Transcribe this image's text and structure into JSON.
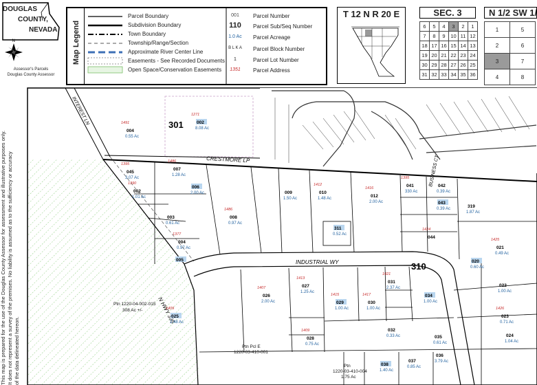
{
  "county": {
    "line1": "DOUGLAS",
    "line2": "COUNTY,",
    "line3": "NEVADA",
    "footer1": "Assessor's Parcels",
    "footer2": "Douglas County Assessor"
  },
  "legend": {
    "title": "Map Legend",
    "left": [
      "Parcel Boundary",
      "Subdivision Boundary",
      "Town Boundary",
      "Township/Range/Section",
      "Approximate River Center Line",
      "Easements - See Recorded Documents",
      "Open Space/Conservation Easements"
    ],
    "right_symbols": [
      "001",
      "110",
      "1.0 Ac",
      "B L K  A",
      "1",
      "1351"
    ],
    "right": [
      "Parcel Number",
      "Parcel Sub/Seq Number",
      "Parcel Acreage",
      "Parcel Block Number",
      "Parcel Lot Number",
      "Parcel Address"
    ]
  },
  "township": {
    "title": "T 12 N  R 20 E"
  },
  "section": {
    "title": "SEC.  3",
    "grid": [
      [
        6,
        5,
        4,
        3,
        2,
        1
      ],
      [
        7,
        8,
        9,
        10,
        11,
        12
      ],
      [
        18,
        17,
        16,
        15,
        14,
        13
      ],
      [
        19,
        20,
        21,
        22,
        23,
        24
      ],
      [
        30,
        29,
        28,
        27,
        26,
        25
      ],
      [
        31,
        32,
        33,
        34,
        35,
        36
      ]
    ],
    "highlight": 3
  },
  "quarter": {
    "title": "N 1/2  SW 1/4",
    "grid": [
      [
        1,
        5
      ],
      [
        2,
        6
      ],
      [
        3,
        7
      ],
      [
        4,
        8
      ]
    ],
    "highlight": 3
  },
  "disclaimer": [
    "This map is prepared for the use of the Douglas County Assessor for assessment and illustrative purposes only.",
    "It does not represent a survey of the premises.  No liability is assumed as to the sufficiency or accuracy",
    "of the data delineated hereon."
  ],
  "map": {
    "roads": {
      "crestmore": "CRESTMORE LP",
      "industrial": "INDUSTRIAL WY",
      "hwy": "N HWY 395",
      "interest": "INTEREST LN",
      "business": "BUSINESS CT"
    },
    "block_numbers": [
      "301",
      "310"
    ],
    "parcels": [
      {
        "num": "002",
        "acres": "8.08 Ac",
        "addr": "1271"
      },
      {
        "num": "004",
        "acres": "0.55 Ac",
        "addr": "1491"
      },
      {
        "num": "045",
        "acres": "3.07 Ac",
        "addr": "1395"
      },
      {
        "num": "007",
        "acres": "1.28 Ac",
        "addr": "1486"
      },
      {
        "num": "006",
        "acres": "2.00 Ac",
        "addr": ""
      },
      {
        "num": "002",
        "acres": "1.01 Ac",
        "addr": "1390"
      },
      {
        "num": "003",
        "acres": "0.61 Ac",
        "addr": ""
      },
      {
        "num": "004",
        "acres": "0.97 Ac",
        "addr": "1377"
      },
      {
        "num": "005",
        "acres": "",
        "addr": ""
      },
      {
        "num": "008",
        "acres": "0.97 Ac",
        "addr": "1486"
      },
      {
        "num": "009",
        "acres": "1.50 Ac",
        "addr": ""
      },
      {
        "num": "010",
        "acres": "1.48 Ac",
        "addr": "1412"
      },
      {
        "num": "311",
        "acres": "0.52 Ac",
        "addr": ""
      },
      {
        "num": "012",
        "acres": "2.00 Ac",
        "addr": "1416"
      },
      {
        "num": "041",
        "acres": "330 Ac",
        "addr": "1395"
      },
      {
        "num": "042",
        "acres": "0.39 Ac",
        "addr": ""
      },
      {
        "num": "043",
        "acres": "0.39 Ac",
        "addr": ""
      },
      {
        "num": "319",
        "acres": "1.87 Ac",
        "addr": ""
      },
      {
        "num": "044",
        "acres": "",
        "addr": "1424"
      },
      {
        "num": "021",
        "acres": "0.49 Ac",
        "addr": "1425"
      },
      {
        "num": "020",
        "acres": "0.60 Ac",
        "addr": ""
      },
      {
        "num": "022",
        "acres": "1.00 Ac",
        "addr": ""
      },
      {
        "num": "023",
        "acres": "0.71 Ac",
        "addr": "1426"
      },
      {
        "num": "024",
        "acres": "1.04 Ac",
        "addr": ""
      },
      {
        "num": "025",
        "acres": "2.48 Ac",
        "addr": "1409"
      },
      {
        "num": "026",
        "acres": "2.00 Ac",
        "addr": "1407"
      },
      {
        "num": "027",
        "acres": "1.25 Ac",
        "addr": "1413"
      },
      {
        "num": "028",
        "acres": "0.75 Ac",
        "addr": "1409"
      },
      {
        "num": "029",
        "acres": "1.00 Ac",
        "addr": "1415"
      },
      {
        "num": "030",
        "acres": "1.00 Ac",
        "addr": "1417"
      },
      {
        "num": "031",
        "acres": "2.37 Ac",
        "addr": "1421"
      },
      {
        "num": "032",
        "acres": "0.33 Ac",
        "addr": ""
      },
      {
        "num": "034",
        "acres": "1.00 Ac",
        "addr": ""
      },
      {
        "num": "035",
        "acres": "0.61 Ac",
        "addr": ""
      },
      {
        "num": "036",
        "acres": "3.79 Ac",
        "addr": ""
      },
      {
        "num": "037",
        "acres": "0.85 Ac",
        "addr": ""
      },
      {
        "num": "038",
        "acres": "1.40 Ac",
        "addr": ""
      }
    ],
    "ptn_labels": [
      {
        "l1": "Ptn 1220-04-002-015",
        "l2": "308 Ac +/-"
      },
      {
        "l1": "Ptn Pcl E",
        "l2": "1220-03-410-001"
      },
      {
        "l1": "Ptn",
        "l2": "1220-03-410-004",
        "l3": "1.75 Ac"
      }
    ]
  },
  "colors": {
    "address": "#c62828",
    "acreage": "#1e5f9e",
    "highlight_box": "#b9d6ef",
    "easement": "#6dbf5a"
  }
}
